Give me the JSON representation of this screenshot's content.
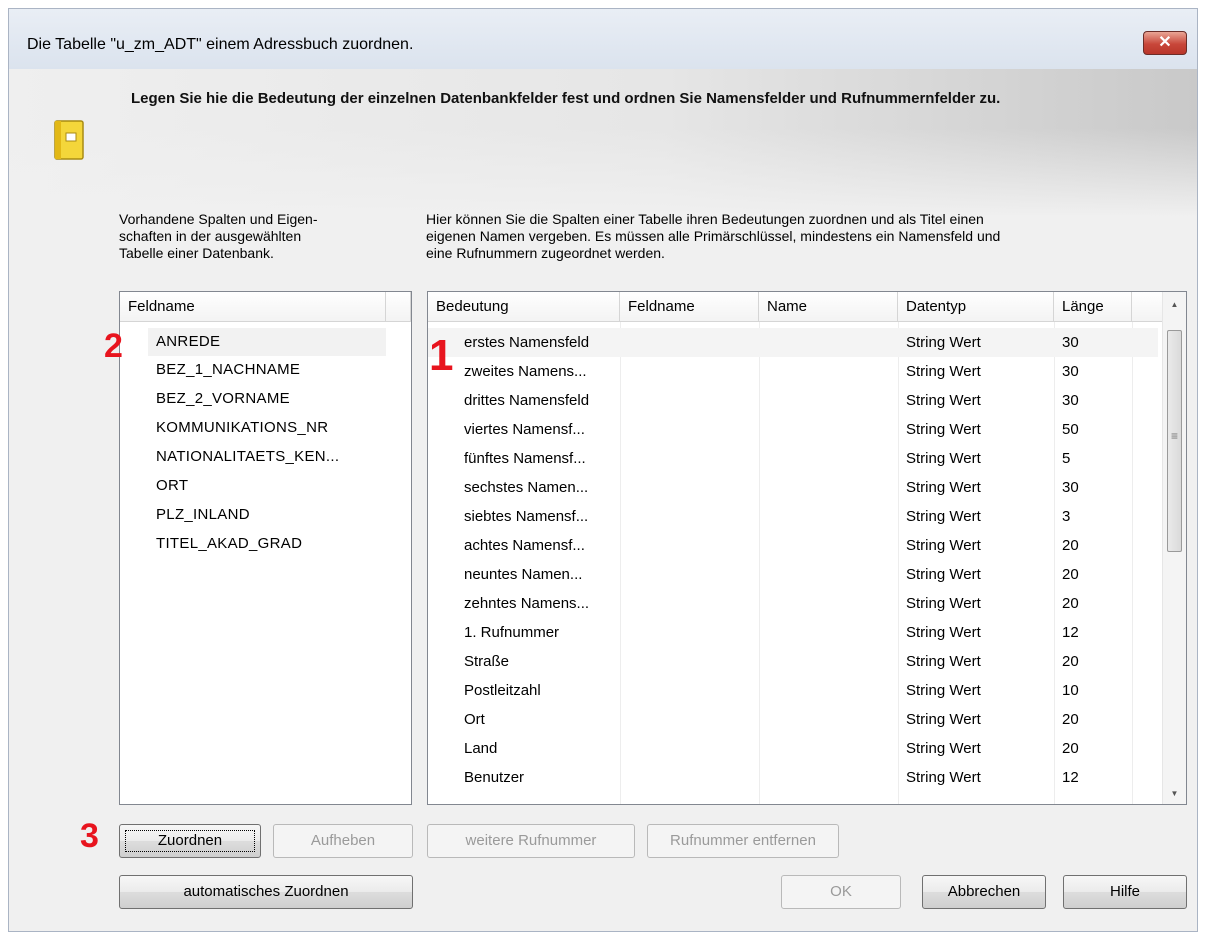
{
  "window": {
    "title": "Die Tabelle \"u_zm_ADT\"  einem Adressbuch zuordnen.",
    "close_label": "✕"
  },
  "banner": {
    "text": "Legen Sie hie die Bedeutung der einzelnen Datenbankfelder fest und ordnen Sie Namensfelder und Rufnummernfelder zu."
  },
  "left_desc": {
    "lines": [
      "Vorhandene Spalten und Eigen-",
      "schaften in der ausgewählten",
      "Tabelle einer Datenbank."
    ]
  },
  "right_desc": {
    "lines": [
      "Hier können Sie die Spalten einer Tabelle ihren Bedeutungen zuordnen und als Titel einen",
      "eigenen Namen vergeben. Es müssen alle Primärschlüssel, mindestens ein Namensfeld und",
      "eine Rufnummern zugeordnet werden."
    ]
  },
  "field_list": {
    "header": "Feldname",
    "items": [
      "ANREDE",
      "BEZ_1_NACHNAME",
      "BEZ_2_VORNAME",
      "KOMMUNIKATIONS_NR",
      "NATIONALITAETS_KEN...",
      "ORT",
      "PLZ_INLAND",
      "TITEL_AKAD_GRAD"
    ]
  },
  "mapping_table": {
    "columns": [
      "Bedeutung",
      "Feldname",
      "Name",
      "Datentyp",
      "Länge"
    ],
    "rows": [
      [
        "erstes Namensfeld",
        "",
        "",
        "String Wert",
        "30"
      ],
      [
        "zweites Namens...",
        "",
        "",
        "String Wert",
        "30"
      ],
      [
        "drittes Namensfeld",
        "",
        "",
        "String Wert",
        "30"
      ],
      [
        "viertes Namensf...",
        "",
        "",
        "String Wert",
        "50"
      ],
      [
        "fünftes Namensf...",
        "",
        "",
        "String Wert",
        "5"
      ],
      [
        "sechstes Namen...",
        "",
        "",
        "String Wert",
        "30"
      ],
      [
        "siebtes Namensf...",
        "",
        "",
        "String Wert",
        "3"
      ],
      [
        "achtes Namensf...",
        "",
        "",
        "String Wert",
        "20"
      ],
      [
        "neuntes Namen...",
        "",
        "",
        "String Wert",
        "20"
      ],
      [
        "zehntes Namens...",
        "",
        "",
        "String Wert",
        "20"
      ],
      [
        "1. Rufnummer",
        "",
        "",
        "String Wert",
        "12"
      ],
      [
        "Straße",
        "",
        "",
        "String Wert",
        "20"
      ],
      [
        "Postleitzahl",
        "",
        "",
        "String Wert",
        "10"
      ],
      [
        "Ort",
        "",
        "",
        "String Wert",
        "20"
      ],
      [
        "Land",
        "",
        "",
        "String Wert",
        "20"
      ],
      [
        "Benutzer",
        "",
        "",
        "String Wert",
        "12"
      ]
    ]
  },
  "markers": [
    "1",
    "2",
    "3"
  ],
  "buttons": {
    "zuordnen": "Zuordnen",
    "aufheben": "Aufheben",
    "weitere_rufnummer": "weitere Rufnummer",
    "rufnummer_entfernen": "Rufnummer entfernen",
    "auto_zuordnen": "automatisches Zuordnen",
    "ok": "OK",
    "abbrechen": "Abbrechen",
    "hilfe": "Hilfe"
  },
  "scrollbar": {
    "up_icon": "▲",
    "down_icon": "▼",
    "grip_icon": "≡"
  },
  "colors": {
    "marker_red": "#e8141e",
    "close_red": "#c8473a"
  }
}
